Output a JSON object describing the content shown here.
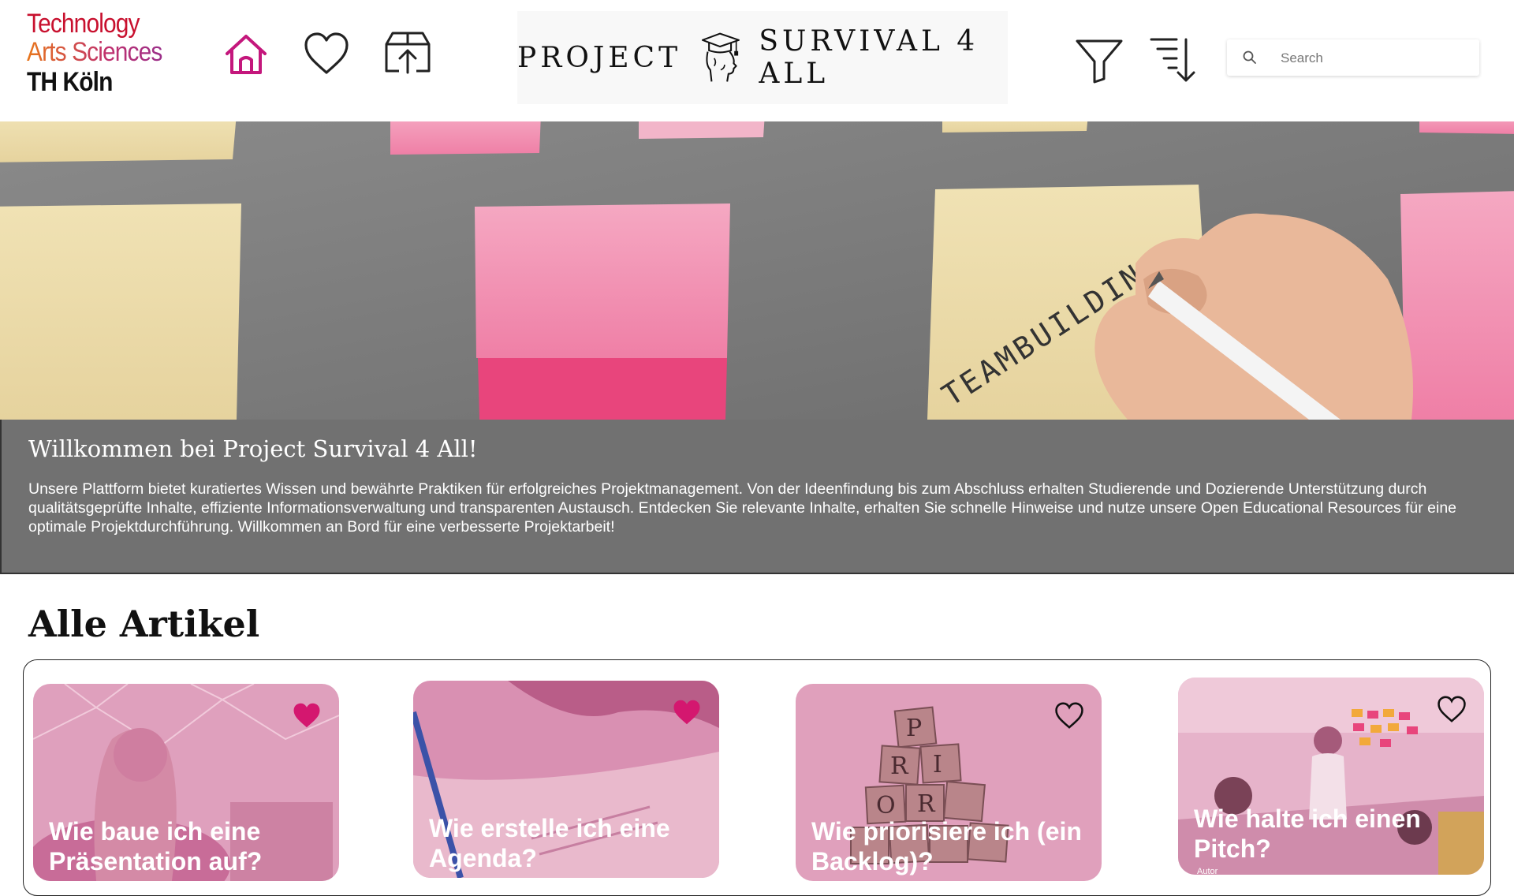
{
  "logo": {
    "line1": "Technology",
    "line2": "Arts Sciences",
    "line3": "TH Köln"
  },
  "nav": [
    {
      "name": "home-icon",
      "color": "#c4177c"
    },
    {
      "name": "heart-icon",
      "color": "#222"
    },
    {
      "name": "upload-box-icon",
      "color": "#222"
    }
  ],
  "brand": {
    "left": "PROJECT",
    "right": "SURVIVAL 4 ALL",
    "icon": "graduate-head-icon"
  },
  "tools": [
    {
      "name": "filter-icon"
    },
    {
      "name": "sort-descending-icon"
    }
  ],
  "search": {
    "placeholder": "Search",
    "value": ""
  },
  "hero": {
    "note_text": "TEAMBUILDING?"
  },
  "welcome": {
    "title": "Willkommen bei Project Survival 4 All!",
    "text": "Unsere Plattform bietet kuratiertes Wissen und bewährte Praktiken für erfolgreiches Projektmanagement. Von der Ideenfindung bis zum Abschluss erhalten Studierende und Dozierende Unterstützung durch qualitätsgeprüfte Inhalte, effiziente Informationsverwaltung und transparenten Austausch. Entdecken Sie relevante Inhalte, erhalten Sie schnelle Hinweise und nutze unsere Open Educational Resources für eine optimale Projektdurchführung. Willkommen an Bord für eine verbesserte Projektarbeit!"
  },
  "section": {
    "title": "Alle Artikel"
  },
  "articles": [
    {
      "title": "Wie baue ich eine Präsentation auf?",
      "favorite": true
    },
    {
      "title": "Wie erstelle ich eine Agenda?",
      "favorite": true
    },
    {
      "title": "Wie priorisiere ich (ein Backlog)?",
      "favorite": false,
      "tiles": [
        "P",
        "R",
        "I",
        "O",
        "R"
      ]
    },
    {
      "title": "Wie halte ich einen Pitch?",
      "favorite": false,
      "subtitle": "Autor"
    }
  ],
  "colors": {
    "accent": "#d4176f",
    "overlay": "#e0609a",
    "banner": "#717171"
  }
}
